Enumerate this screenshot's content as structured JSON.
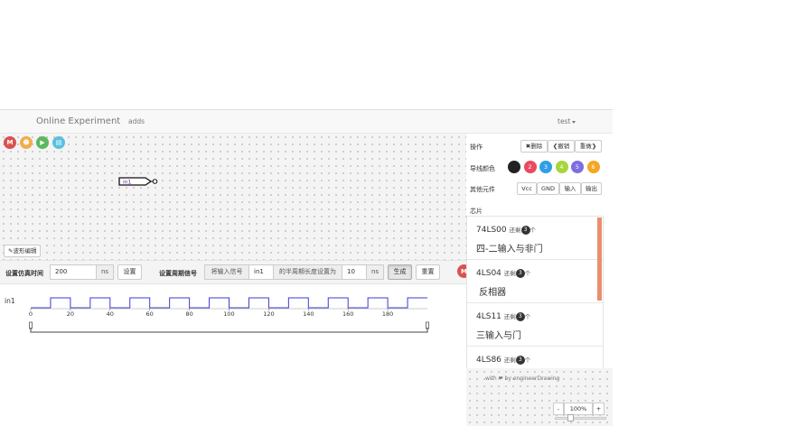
{
  "navbar": {
    "brand": "Online Experiment",
    "link": "adds",
    "user": "test"
  },
  "toolbar_icons": [
    {
      "glyph": "M",
      "color": "#d9534f",
      "icon": "reset-icon"
    },
    {
      "glyph": "☻",
      "color": "#f0ad4e",
      "icon": "user-icon"
    },
    {
      "glyph": "▶",
      "color": "#5cb85c",
      "icon": "play-icon"
    },
    {
      "glyph": "▤",
      "color": "#5bc0de",
      "icon": "list-icon"
    }
  ],
  "canvas": {
    "input_label": "in1",
    "waveform_edit": "波形编辑"
  },
  "sim": {
    "time_label": "设置仿真时间",
    "time_value": "200",
    "time_unit": "ns",
    "set_button": "设置",
    "period_label": "设置周期信号",
    "signal_prefix": "将输入信号",
    "signal_value": "in1",
    "half_period_text": "的半周期长度设置为",
    "half_period_value": "10",
    "half_period_unit": "ns",
    "generate_button": "生成",
    "reset_button": "重置",
    "m_button": "M"
  },
  "timeline": {
    "signal": "in1",
    "ticks": [
      "0",
      "20",
      "40",
      "60",
      "80",
      "100",
      "120",
      "140",
      "160",
      "180"
    ]
  },
  "panel": {
    "operations_label": "操作",
    "delete_label": "删除",
    "undo_label": "撤销",
    "redo_label": "重做",
    "wire_color_label": "导线颜色",
    "colors": [
      {
        "num": "",
        "hex": "#222222"
      },
      {
        "num": "2",
        "hex": "#e84a5f"
      },
      {
        "num": "3",
        "hex": "#2e9fe6"
      },
      {
        "num": "4",
        "hex": "#a6d63c"
      },
      {
        "num": "5",
        "hex": "#7d6ee0"
      },
      {
        "num": "6",
        "hex": "#f5a623"
      }
    ],
    "other_label": "其他元件",
    "other_buttons": [
      "Vcc",
      "GND",
      "输入",
      "输出"
    ],
    "chips_label": "芯片",
    "remaining_prefix": "还剩",
    "remaining_suffix": "个",
    "chips": [
      {
        "name": "74LS00",
        "count": "3",
        "desc": "四-二输入与非门"
      },
      {
        "name": "4LS04",
        "count": "3",
        "desc": " 反相器"
      },
      {
        "name": "4LS11",
        "count": "3",
        "desc": "三输入与门"
      },
      {
        "name": "4LS86",
        "count": "3",
        "desc": ""
      }
    ],
    "credit": "with ❤ by engineerDrawing"
  },
  "zoom": {
    "minus": "-",
    "level": "100%",
    "plus": "+"
  }
}
